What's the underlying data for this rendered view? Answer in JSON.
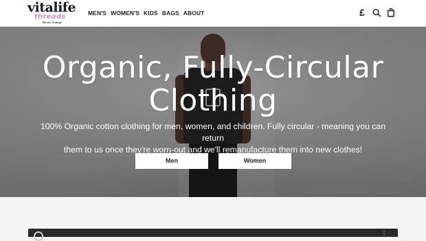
{
  "header": {
    "logo": {
      "main": "vitalife",
      "sub": "threads",
      "tagline": "Be the Change"
    },
    "nav": [
      "MEN'S",
      "WOMEN'S",
      "KIDS",
      "BAGS",
      "ABOUT"
    ],
    "icons": {
      "currency": "£",
      "search": "search-icon",
      "bag": "bag-icon"
    }
  },
  "hero": {
    "title_line1": "Organic, Fully-Circular",
    "title_line2": "Clothing",
    "subtitle_line1": "100% Organic cotton clothing for men, women, and children. Fully circular - meaning you can return",
    "subtitle_line2": "them to us once they're worn-out and we'll remanufacture them into new clothes!",
    "buttons": {
      "men": "Men",
      "women": "Women"
    }
  },
  "colors": {
    "header_bg": "#ffffff",
    "logo_accent": "#e58db5",
    "button_bg": "#ffffff",
    "page_bg": "#f4f4f4",
    "video_bar": "#2a2a2a"
  }
}
